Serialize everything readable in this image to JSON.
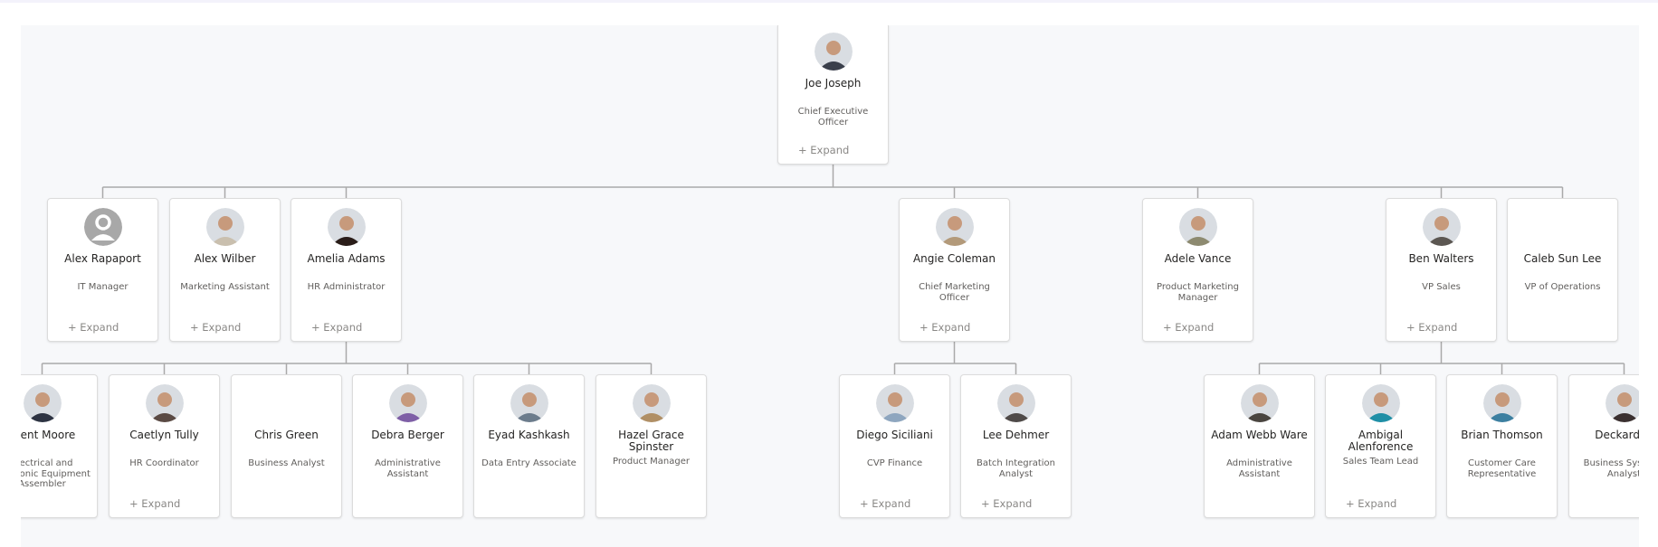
{
  "chart": {
    "root": {
      "name": "Joe Joseph",
      "title": "Chief Executive Officer",
      "expand": "+ Expand",
      "avatar": "photo",
      "avatar_tone": "#3a3f4b"
    },
    "level1": [
      {
        "name": "Alex Rapaport",
        "title": "IT Manager",
        "expand": "+ Expand",
        "avatar": "placeholder-user-icon",
        "avatar_tone": "#a8a8a8"
      },
      {
        "name": "Alex Wilber",
        "title": "Marketing Assistant",
        "expand": "+ Expand",
        "avatar": "photo",
        "avatar_tone": "#c9bfae"
      },
      {
        "name": "Amelia Adams",
        "title": "HR Administrator",
        "expand": "+ Expand",
        "avatar": "photo",
        "avatar_tone": "#2a1d19"
      },
      {
        "name": "Angie Coleman",
        "title": "Chief Marketing Officer",
        "expand": "+ Expand",
        "avatar": "photo",
        "avatar_tone": "#b39a7a"
      },
      {
        "name": "Adele Vance",
        "title": "Product Marketing Manager",
        "expand": "+ Expand",
        "avatar": "photo",
        "avatar_tone": "#8d8a70"
      },
      {
        "name": "Ben Walters",
        "title": "VP Sales",
        "expand": "+ Expand",
        "avatar": "photo",
        "avatar_tone": "#5c5752"
      },
      {
        "name": "Caleb Sun Lee",
        "title": "VP of Operations",
        "expand": null,
        "avatar": null,
        "avatar_tone": null
      }
    ],
    "level2": [
      {
        "name": "Brent Moore",
        "title": "Electrical and Electronic Equipment Assembler",
        "expand": null,
        "avatar": "photo",
        "avatar_tone": "#2d3342"
      },
      {
        "name": "Caetlyn Tully",
        "title": "HR Coordinator",
        "expand": "+ Expand",
        "avatar": "photo",
        "avatar_tone": "#5a4a44"
      },
      {
        "name": "Chris Green",
        "title": "Business Analyst",
        "expand": null,
        "avatar": null,
        "avatar_tone": null
      },
      {
        "name": "Debra Berger",
        "title": "Administrative Assistant",
        "expand": null,
        "avatar": "photo",
        "avatar_tone": "#7e5fa6"
      },
      {
        "name": "Eyad Kashkash",
        "title": "Data Entry Associate",
        "expand": null,
        "avatar": "photo",
        "avatar_tone": "#6c7c8c"
      },
      {
        "name": "Hazel Grace Spinster",
        "title": "Product Manager",
        "expand": null,
        "avatar": "photo",
        "avatar_tone": "#b08f65"
      },
      {
        "name": "Diego Siciliani",
        "title": "CVP Finance",
        "expand": "+ Expand",
        "avatar": "photo",
        "avatar_tone": "#8ea6bf"
      },
      {
        "name": "Lee Dehmer",
        "title": "Batch Integration Analyst",
        "expand": "+ Expand",
        "avatar": "photo",
        "avatar_tone": "#4f4a48"
      },
      {
        "name": "Adam Webb Ware",
        "title": "Administrative Assistant",
        "expand": null,
        "avatar": "photo",
        "avatar_tone": "#4a4540"
      },
      {
        "name": "Ambigal Alenforence",
        "title": "Sales Team Lead",
        "expand": "+ Expand",
        "avatar": "photo",
        "avatar_tone": "#1f8fa6"
      },
      {
        "name": "Brian Thomson",
        "title": "Customer Care Representative",
        "expand": null,
        "avatar": "photo",
        "avatar_tone": "#3c7fa0"
      },
      {
        "name": "Deckard Sl",
        "title": "Business Systems Analyst",
        "expand": null,
        "avatar": "photo",
        "avatar_tone": "#3a3030"
      }
    ]
  },
  "colors": {
    "connector": "#a9a9a9",
    "canvas": "#f7f8fa"
  }
}
